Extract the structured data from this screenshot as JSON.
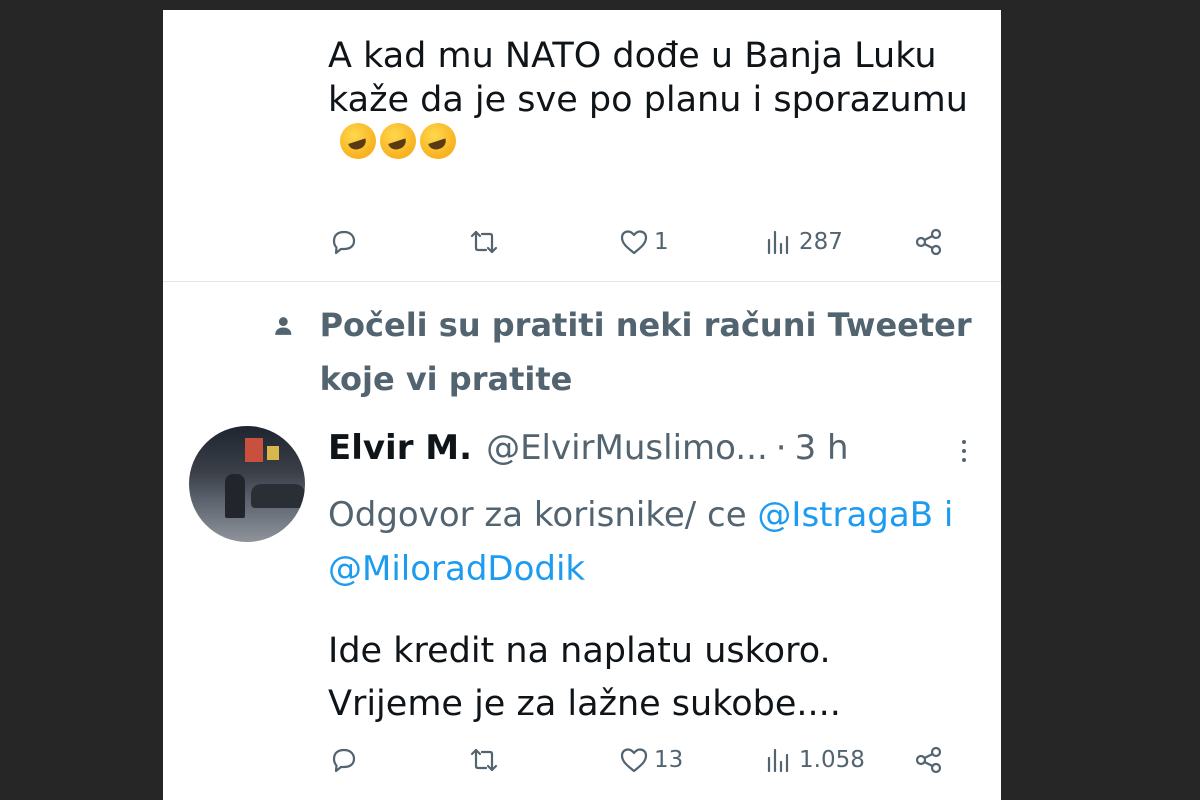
{
  "tweet1": {
    "text": "A kad mu NATO dođe u Banja Luku kaže da je sve po planu i sporazumu",
    "emojis": [
      "rolling-on-floor-laughing",
      "rolling-on-floor-laughing",
      "rolling-on-floor-laughing"
    ],
    "likes": "1",
    "views": "287"
  },
  "follow_note": {
    "text": "Počeli su pratiti neki računi Tweeter koje vi pratite"
  },
  "tweet2": {
    "name": "Elvir M.",
    "handle": "@ElvirMuslimo...",
    "dot": "·",
    "time": "3 h",
    "reply_prefix": "Odgovor za korisnike/ ce",
    "mention1": "@IstragaB",
    "conj": "i",
    "mention2": "@MiloradDodik",
    "text": "Ide kredit na naplatu uskoro. Vrijeme je za lažne sukobe....",
    "likes": "13",
    "views": "1.058"
  },
  "colors": {
    "text": "#0f1419",
    "secondary": "#536471",
    "link": "#1d9bf0",
    "background": "#262626",
    "card": "#ffffff"
  },
  "icons": [
    "reply-icon",
    "retweet-icon",
    "like-icon",
    "views-icon",
    "share-icon",
    "person-icon",
    "more-icon"
  ]
}
